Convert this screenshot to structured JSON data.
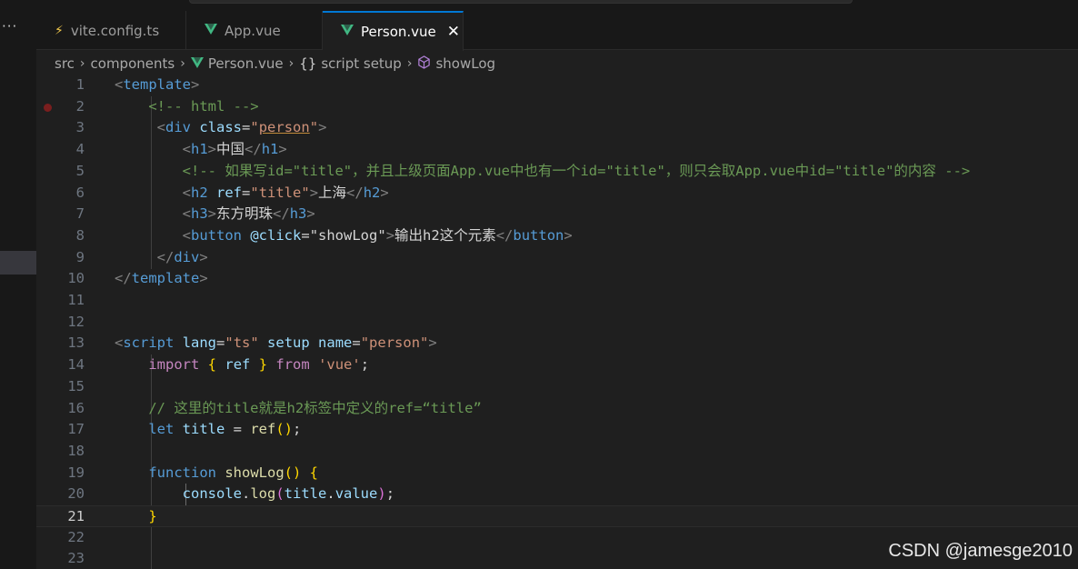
{
  "tabs": [
    {
      "label": "vite.config.ts",
      "icon": "lightning-icon",
      "active": false
    },
    {
      "label": "App.vue",
      "icon": "vue-icon",
      "active": false
    },
    {
      "label": "Person.vue",
      "icon": "vue-icon",
      "active": true
    }
  ],
  "more_label": "···",
  "close_label": "✕",
  "breadcrumbs": [
    {
      "label": "src"
    },
    {
      "label": "components"
    },
    {
      "label": "Person.vue",
      "icon": "vue-icon"
    },
    {
      "label": "script setup",
      "icon": "braces-icon"
    },
    {
      "label": "showLog",
      "icon": "cube-icon"
    }
  ],
  "editor": {
    "current_line": 21,
    "breakpoint_line": 2,
    "lines": [
      {
        "n": "1",
        "t": [
          [
            "tg",
            "<"
          ],
          [
            "tn",
            "template"
          ],
          [
            "tg",
            ">"
          ]
        ]
      },
      {
        "n": "2",
        "t": [
          [
            "cm",
            "    <!-- html -->"
          ]
        ]
      },
      {
        "n": "3",
        "t": [
          [
            "tx",
            "     "
          ],
          [
            "tg",
            "<"
          ],
          [
            "tn",
            "div"
          ],
          [
            "tx",
            " "
          ],
          [
            "at",
            "class"
          ],
          [
            "tx",
            "="
          ],
          [
            "st",
            "\""
          ],
          [
            "st",
            "person"
          ],
          [
            "st",
            "\""
          ],
          [
            "tg",
            ">"
          ]
        ]
      },
      {
        "n": "4",
        "t": [
          [
            "tx",
            "        "
          ],
          [
            "tg",
            "<"
          ],
          [
            "tn",
            "h1"
          ],
          [
            "tg",
            ">"
          ],
          [
            "tx",
            "中国"
          ],
          [
            "tg",
            "</"
          ],
          [
            "tn",
            "h1"
          ],
          [
            "tg",
            ">"
          ]
        ]
      },
      {
        "n": "5",
        "t": [
          [
            "cm",
            "        <!-- 如果写id=\"title\"，并且上级页面App.vue中也有一个id=\"title\"，则只会取App.vue中id=\"title\"的内容 -->"
          ]
        ]
      },
      {
        "n": "6",
        "t": [
          [
            "tx",
            "        "
          ],
          [
            "tg",
            "<"
          ],
          [
            "tn",
            "h2"
          ],
          [
            "tx",
            " "
          ],
          [
            "at",
            "ref"
          ],
          [
            "tx",
            "="
          ],
          [
            "st",
            "\"title\""
          ],
          [
            "tg",
            ">"
          ],
          [
            "tx",
            "上海"
          ],
          [
            "tg",
            "</"
          ],
          [
            "tn",
            "h2"
          ],
          [
            "tg",
            ">"
          ]
        ]
      },
      {
        "n": "7",
        "t": [
          [
            "tx",
            "        "
          ],
          [
            "tg",
            "<"
          ],
          [
            "tn",
            "h3"
          ],
          [
            "tg",
            ">"
          ],
          [
            "tx",
            "东方明珠"
          ],
          [
            "tg",
            "</"
          ],
          [
            "tn",
            "h3"
          ],
          [
            "tg",
            ">"
          ]
        ]
      },
      {
        "n": "8",
        "t": [
          [
            "tx",
            "        "
          ],
          [
            "tg",
            "<"
          ],
          [
            "tn",
            "button"
          ],
          [
            "tx",
            " "
          ],
          [
            "at",
            "@click"
          ],
          [
            "tx",
            "="
          ],
          [
            "tx",
            "\"showLog\""
          ],
          [
            "tg",
            ">"
          ],
          [
            "tx",
            "输出h2这个元素"
          ],
          [
            "tg",
            "</"
          ],
          [
            "tn",
            "button"
          ],
          [
            "tg",
            ">"
          ]
        ]
      },
      {
        "n": "9",
        "t": [
          [
            "tx",
            "     "
          ],
          [
            "tg",
            "</"
          ],
          [
            "tn",
            "div"
          ],
          [
            "tg",
            ">"
          ]
        ]
      },
      {
        "n": "10",
        "t": [
          [
            "tg",
            "</"
          ],
          [
            "tn",
            "template"
          ],
          [
            "tg",
            ">"
          ]
        ]
      },
      {
        "n": "11",
        "t": []
      },
      {
        "n": "12",
        "t": []
      },
      {
        "n": "13",
        "t": [
          [
            "tg",
            "<"
          ],
          [
            "tn",
            "script"
          ],
          [
            "tx",
            " "
          ],
          [
            "at",
            "lang"
          ],
          [
            "tx",
            "="
          ],
          [
            "st",
            "\"ts\""
          ],
          [
            "tx",
            " "
          ],
          [
            "at",
            "setup"
          ],
          [
            "tx",
            " "
          ],
          [
            "at",
            "name"
          ],
          [
            "tx",
            "="
          ],
          [
            "st",
            "\"person\""
          ],
          [
            "tg",
            ">"
          ]
        ]
      },
      {
        "n": "14",
        "t": [
          [
            "tx",
            "    "
          ],
          [
            "kw",
            "import"
          ],
          [
            "tx",
            " "
          ],
          [
            "br",
            "{"
          ],
          [
            "tx",
            " "
          ],
          [
            "at",
            "ref"
          ],
          [
            "tx",
            " "
          ],
          [
            "br",
            "}"
          ],
          [
            "tx",
            " "
          ],
          [
            "kw",
            "from"
          ],
          [
            "tx",
            " "
          ],
          [
            "st",
            "'vue'"
          ],
          [
            "tx",
            ";"
          ]
        ]
      },
      {
        "n": "15",
        "t": []
      },
      {
        "n": "16",
        "t": [
          [
            "cm",
            "    // 这里的title就是h2标签中定义的ref=“title”"
          ]
        ]
      },
      {
        "n": "17",
        "t": [
          [
            "tx",
            "    "
          ],
          [
            "kb",
            "let"
          ],
          [
            "tx",
            " "
          ],
          [
            "at",
            "title"
          ],
          [
            "tx",
            " = "
          ],
          [
            "fn",
            "ref"
          ],
          [
            "br",
            "()"
          ],
          [
            "tx",
            ";"
          ]
        ]
      },
      {
        "n": "18",
        "t": []
      },
      {
        "n": "19",
        "t": [
          [
            "tx",
            "    "
          ],
          [
            "kb",
            "function"
          ],
          [
            "tx",
            " "
          ],
          [
            "fn",
            "showLog"
          ],
          [
            "br",
            "()"
          ],
          [
            "tx",
            " "
          ],
          [
            "br",
            "{"
          ]
        ]
      },
      {
        "n": "20",
        "t": [
          [
            "tx",
            "        "
          ],
          [
            "at",
            "console"
          ],
          [
            "tx",
            "."
          ],
          [
            "fn",
            "log"
          ],
          [
            "bp2",
            "("
          ],
          [
            "at",
            "title"
          ],
          [
            "tx",
            "."
          ],
          [
            "at",
            "value"
          ],
          [
            "bp2",
            ")"
          ],
          [
            "tx",
            ";"
          ]
        ]
      },
      {
        "n": "21",
        "t": [
          [
            "tx",
            "    "
          ],
          [
            "br",
            "}"
          ]
        ]
      },
      {
        "n": "22",
        "t": []
      },
      {
        "n": "23",
        "t": []
      }
    ]
  },
  "watermark": "CSDN @jamesge2010"
}
